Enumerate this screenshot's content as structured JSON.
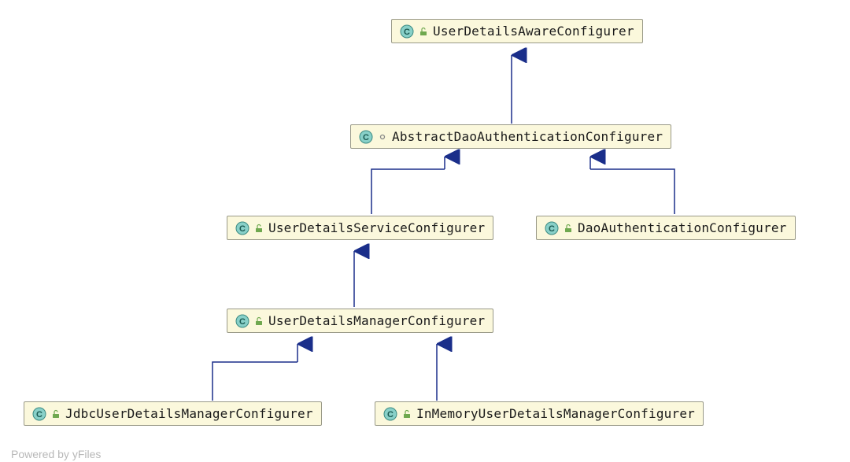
{
  "nodes": {
    "n0": {
      "name": "UserDetailsAwareConfigurer",
      "modifier": "unlocked"
    },
    "n1": {
      "name": "AbstractDaoAuthenticationConfigurer",
      "modifier": "abstract-dot"
    },
    "n2": {
      "name": "UserDetailsServiceConfigurer",
      "modifier": "unlocked"
    },
    "n3": {
      "name": "DaoAuthenticationConfigurer",
      "modifier": "unlocked"
    },
    "n4": {
      "name": "UserDetailsManagerConfigurer",
      "modifier": "unlocked"
    },
    "n5": {
      "name": "JdbcUserDetailsManagerConfigurer",
      "modifier": "unlocked"
    },
    "n6": {
      "name": "InMemoryUserDetailsManagerConfigurer",
      "modifier": "unlocked"
    }
  },
  "footer": "Powered by yFiles"
}
